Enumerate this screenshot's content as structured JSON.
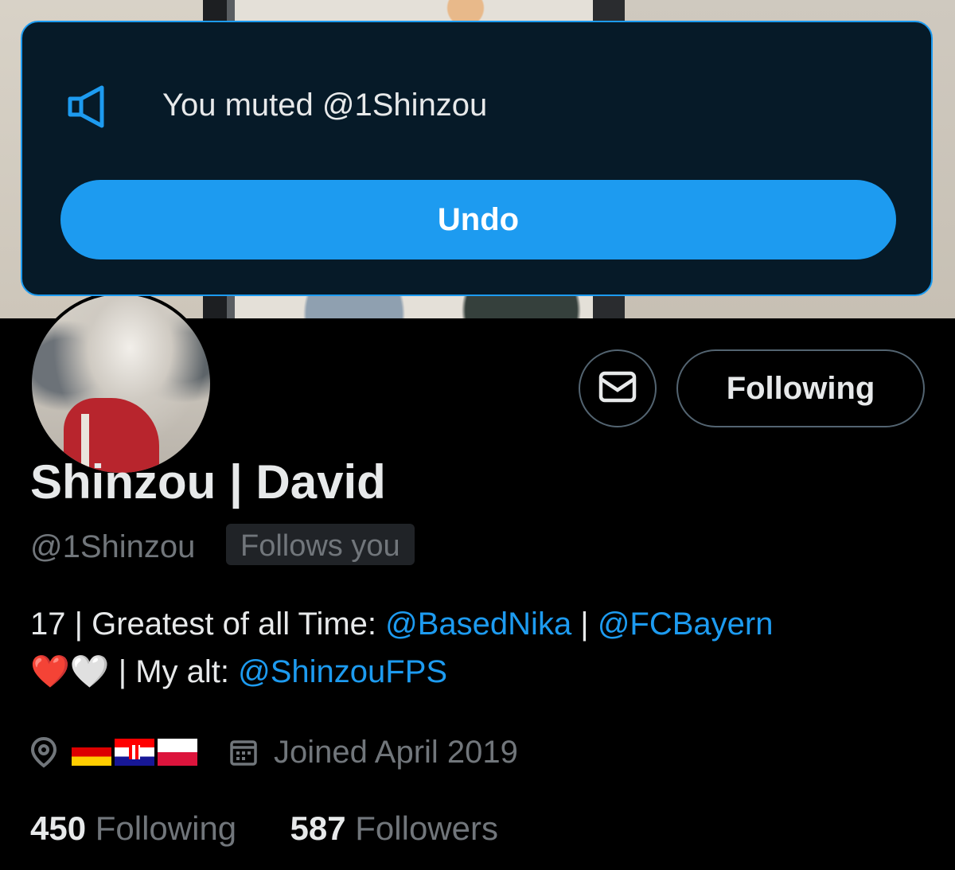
{
  "toast": {
    "icon": "speaker-muted-icon",
    "message": "You muted @1Shinzou",
    "undo_label": "Undo"
  },
  "profile": {
    "display_name": "Shinzou | David",
    "handle": "@1Shinzou",
    "follows_you_badge": "Follows you",
    "bio": {
      "prefix": "17 | Greatest of all Time: ",
      "mention1": "@BasedNika",
      "separator": " | ",
      "mention2": "@FCBayern",
      "hearts": "❤️🤍",
      "alt_text": " | My alt: ",
      "mention3": "@ShinzouFPS"
    },
    "location_flags": [
      "germany-flag",
      "croatia-flag",
      "poland-flag"
    ],
    "joined": "Joined April 2019",
    "following_count": "450",
    "following_label": "Following",
    "followers_count": "587",
    "followers_label": "Followers"
  },
  "actions": {
    "message_icon": "envelope-icon",
    "follow_button_label": "Following"
  },
  "colors": {
    "accent": "#1d9bf0",
    "toast_bg": "#061a28",
    "muted_text": "#71767b"
  }
}
